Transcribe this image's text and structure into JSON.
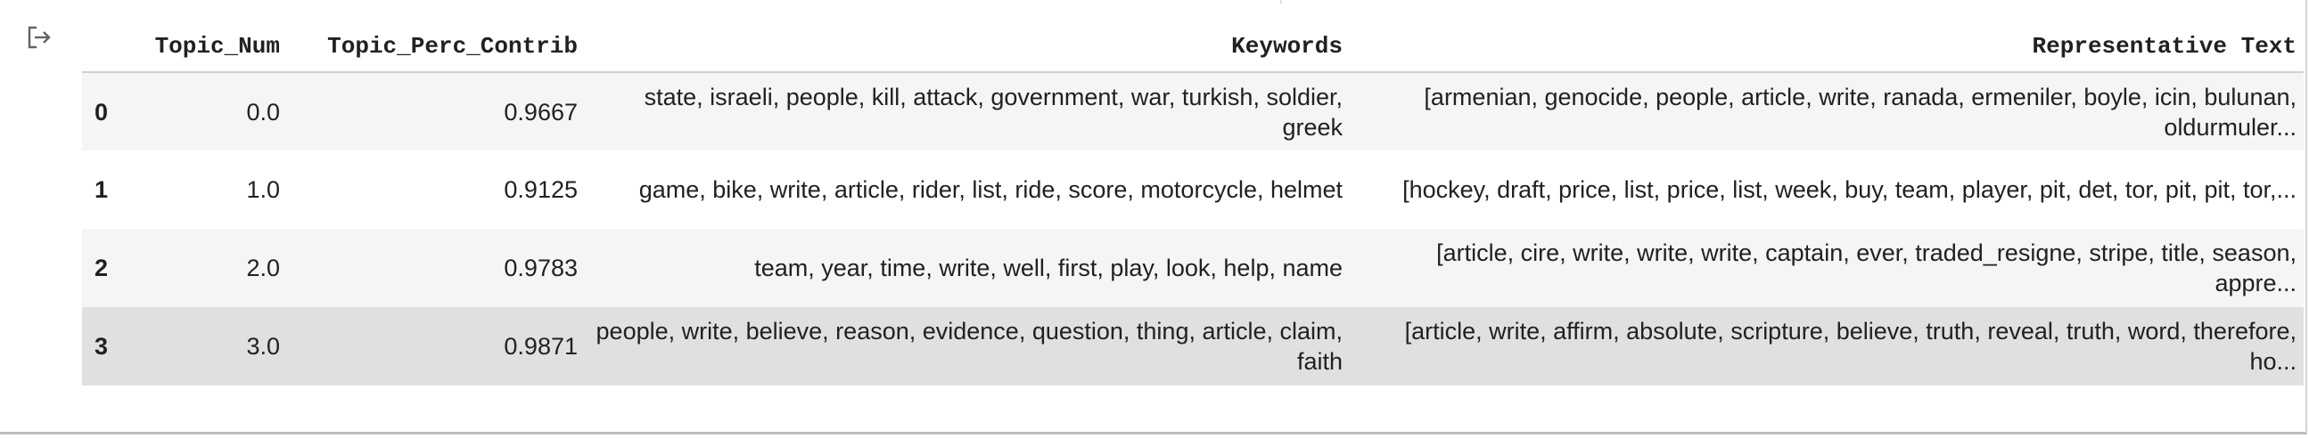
{
  "output": {
    "icon": "output-redirect-icon"
  },
  "table": {
    "columns": [
      "",
      "Topic_Num",
      "Topic_Perc_Contrib",
      "Keywords",
      "Representative Text"
    ],
    "rows": [
      {
        "index": "0",
        "topic_num": "0.0",
        "perc": "0.9667",
        "keywords": "state, israeli, people, kill, attack, government, war, turkish, soldier, greek",
        "text": "[armenian, genocide, people, article, write, ranada, ermeniler, boyle, icin, bulunan, oldurmuler..."
      },
      {
        "index": "1",
        "topic_num": "1.0",
        "perc": "0.9125",
        "keywords": "game, bike, write, article, rider, list, ride, score, motorcycle, helmet",
        "text": "[hockey, draft, price, list, price, list, week, buy, team, player, pit, det, tor, pit, pit, tor,..."
      },
      {
        "index": "2",
        "topic_num": "2.0",
        "perc": "0.9783",
        "keywords": "team, year, time, write, well, first, play, look, help, name",
        "text": "[article, cire, write, write, write, captain, ever, traded_resigne, stripe, title, season, appre..."
      },
      {
        "index": "3",
        "topic_num": "3.0",
        "perc": "0.9871",
        "keywords": "people, write, believe, reason, evidence, question, thing, article, claim, faith",
        "text": "[article, write, affirm, absolute, scripture, believe, truth, reveal, truth, word, therefore, ho..."
      }
    ]
  }
}
